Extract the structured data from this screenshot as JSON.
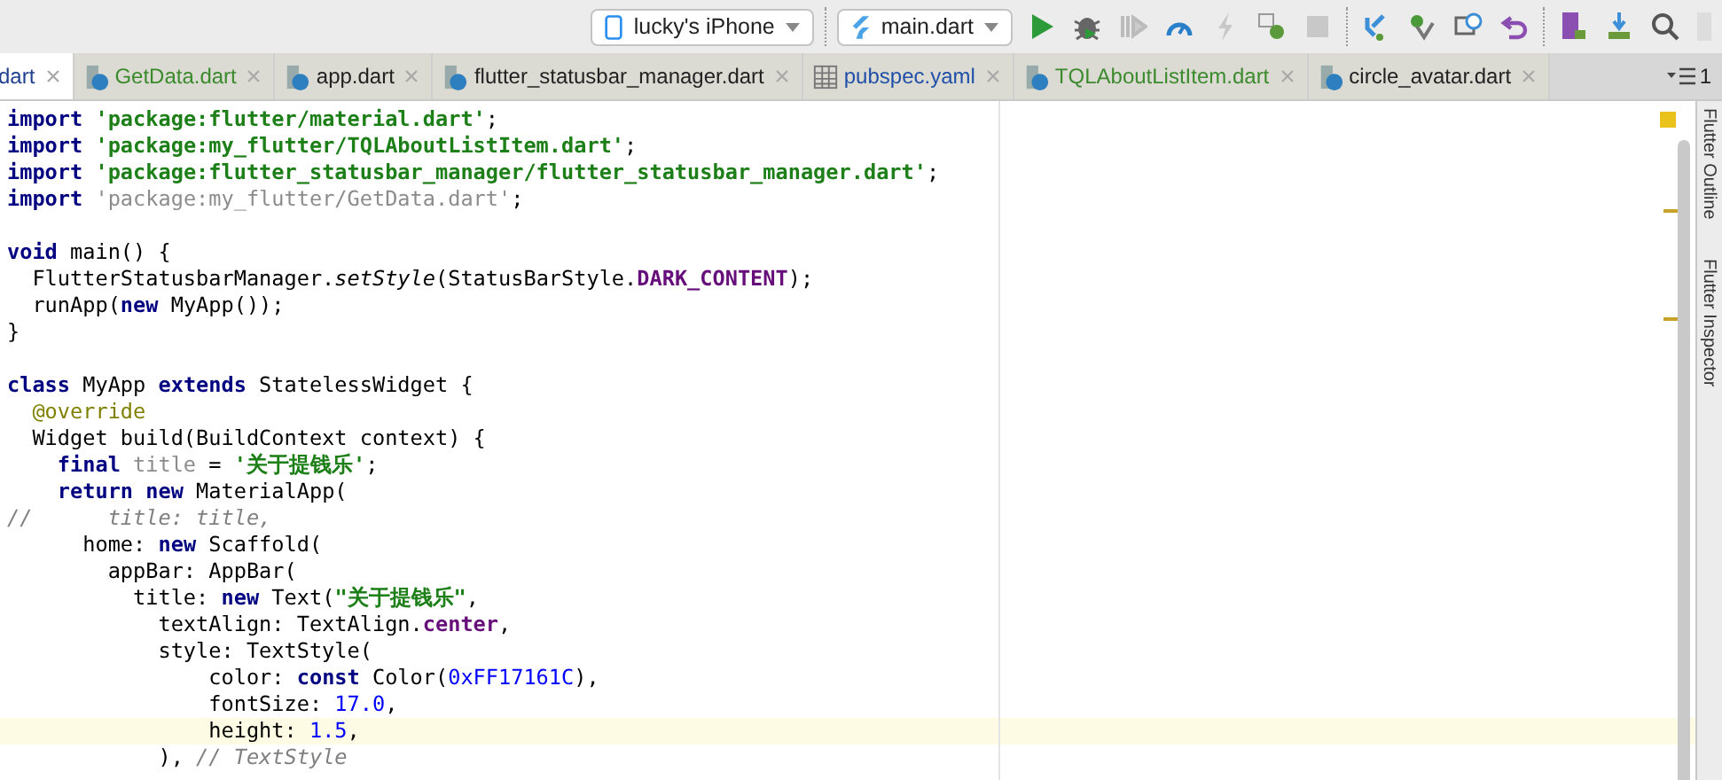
{
  "toolbar": {
    "device": "lucky's iPhone",
    "run_config": "main.dart"
  },
  "tabs": [
    {
      "label": "dart",
      "selected": true,
      "color": "#1f3f8f",
      "kind": "dart"
    },
    {
      "label": "GetData.dart",
      "selected": false,
      "color": "#3c8a2e",
      "kind": "dart"
    },
    {
      "label": "app.dart",
      "selected": false,
      "color": "#222222",
      "kind": "dart"
    },
    {
      "label": "flutter_statusbar_manager.dart",
      "selected": false,
      "color": "#222222",
      "kind": "dart"
    },
    {
      "label": "pubspec.yaml",
      "selected": false,
      "color": "#1f4fa8",
      "kind": "yaml"
    },
    {
      "label": "TQLAboutListItem.dart",
      "selected": false,
      "color": "#3c8a2e",
      "kind": "dart"
    },
    {
      "label": "circle_avatar.dart",
      "selected": false,
      "color": "#222222",
      "kind": "dart"
    }
  ],
  "tab_overflow_count": "1",
  "code_lines": [
    {
      "current": false,
      "tokens": [
        {
          "kind": "kw",
          "t": "import"
        },
        {
          "kind": "str",
          "t": " 'package:flutter/material.dart'"
        },
        {
          "kind": "p",
          "t": ";"
        }
      ]
    },
    {
      "current": false,
      "tokens": [
        {
          "kind": "kw",
          "t": "import"
        },
        {
          "kind": "str",
          "t": " 'package:my_flutter/TQLAboutListItem.dart'"
        },
        {
          "kind": "p",
          "t": ";"
        }
      ]
    },
    {
      "current": false,
      "tokens": [
        {
          "kind": "kw",
          "t": "import"
        },
        {
          "kind": "str",
          "t": " 'package:flutter_statusbar_manager/flutter_statusbar_manager.dart'"
        },
        {
          "kind": "p",
          "t": ";"
        }
      ]
    },
    {
      "current": false,
      "tokens": [
        {
          "kind": "kw",
          "t": "import"
        },
        {
          "kind": "unused",
          "t": " 'package:my_flutter/GetData.dart'"
        },
        {
          "kind": "p",
          "t": ";"
        }
      ]
    },
    {
      "current": false
    },
    {
      "current": false,
      "tokens": [
        {
          "kind": "kw",
          "t": "void"
        },
        {
          "kind": "p",
          "t": " main() {"
        }
      ]
    },
    {
      "current": false,
      "tokens": [
        {
          "kind": "p",
          "t": "  FlutterStatusbarManager."
        },
        {
          "kind": "it",
          "t": "setStyle"
        },
        {
          "kind": "p",
          "t": "(StatusBarStyle."
        },
        {
          "kind": "const",
          "t": "DARK_CONTENT"
        },
        {
          "kind": "p",
          "t": ");"
        }
      ]
    },
    {
      "current": false,
      "tokens": [
        {
          "kind": "p",
          "t": "  runApp("
        },
        {
          "kind": "kw",
          "t": "new"
        },
        {
          "kind": "p",
          "t": " MyApp());"
        }
      ]
    },
    {
      "current": false,
      "tokens": [
        {
          "kind": "p",
          "t": "}"
        }
      ]
    },
    {
      "current": false
    },
    {
      "current": false,
      "tokens": [
        {
          "kind": "kw",
          "t": "class"
        },
        {
          "kind": "p",
          "t": " MyApp "
        },
        {
          "kind": "kw",
          "t": "extends"
        },
        {
          "kind": "p",
          "t": " StatelessWidget {"
        }
      ]
    },
    {
      "current": false,
      "tokens": [
        {
          "kind": "ann",
          "t": "  @override"
        }
      ]
    },
    {
      "current": false,
      "tokens": [
        {
          "kind": "p",
          "t": "  Widget build(BuildContext context) {"
        }
      ]
    },
    {
      "current": false,
      "tokens": [
        {
          "kind": "kw",
          "t": "    final"
        },
        {
          "kind": "unused",
          "t": " title"
        },
        {
          "kind": "p",
          "t": " ="
        },
        {
          "kind": "str",
          "t": " '关于提钱乐'"
        },
        {
          "kind": "p",
          "t": ";"
        }
      ]
    },
    {
      "current": false,
      "tokens": [
        {
          "kind": "kw",
          "t": "    return new"
        },
        {
          "kind": "p",
          "t": " MaterialApp("
        }
      ]
    },
    {
      "current": false,
      "tokens": [
        {
          "kind": "com",
          "t": "//      title: title,"
        }
      ]
    },
    {
      "current": false,
      "tokens": [
        {
          "kind": "p",
          "t": "      home: "
        },
        {
          "kind": "kw",
          "t": "new"
        },
        {
          "kind": "p",
          "t": " Scaffold("
        }
      ]
    },
    {
      "current": false,
      "tokens": [
        {
          "kind": "p",
          "t": "        appBar: AppBar("
        }
      ]
    },
    {
      "current": false,
      "tokens": [
        {
          "kind": "p",
          "t": "          title: "
        },
        {
          "kind": "kw",
          "t": "new"
        },
        {
          "kind": "p",
          "t": " Text("
        },
        {
          "kind": "str",
          "t": "\"关于提钱乐\""
        },
        {
          "kind": "p",
          "t": ","
        }
      ]
    },
    {
      "current": false,
      "tokens": [
        {
          "kind": "p",
          "t": "            textAlign: TextAlign."
        },
        {
          "kind": "const",
          "t": "center"
        },
        {
          "kind": "p",
          "t": ","
        }
      ]
    },
    {
      "current": false,
      "tokens": [
        {
          "kind": "p",
          "t": "            style: TextStyle("
        }
      ]
    },
    {
      "current": false,
      "tokens": [
        {
          "kind": "p",
          "t": "                color: "
        },
        {
          "kind": "kw",
          "t": "const"
        },
        {
          "kind": "p",
          "t": " Color("
        },
        {
          "kind": "num",
          "t": "0xFF17161C"
        },
        {
          "kind": "p",
          "t": "),"
        }
      ]
    },
    {
      "current": false,
      "tokens": [
        {
          "kind": "p",
          "t": "                fontSize: "
        },
        {
          "kind": "num",
          "t": "17.0"
        },
        {
          "kind": "p",
          "t": ","
        }
      ]
    },
    {
      "current": true,
      "tokens": [
        {
          "kind": "p",
          "t": "                height: "
        },
        {
          "kind": "num",
          "t": "1.5"
        },
        {
          "kind": "p",
          "t": ","
        }
      ]
    },
    {
      "current": false,
      "tokens": [
        {
          "kind": "p",
          "t": "            ), "
        },
        {
          "kind": "com",
          "t": "// TextStyle"
        }
      ]
    }
  ],
  "side_panels": [
    {
      "label": "Flutter Outline"
    },
    {
      "label": "Flutter Inspector"
    }
  ]
}
